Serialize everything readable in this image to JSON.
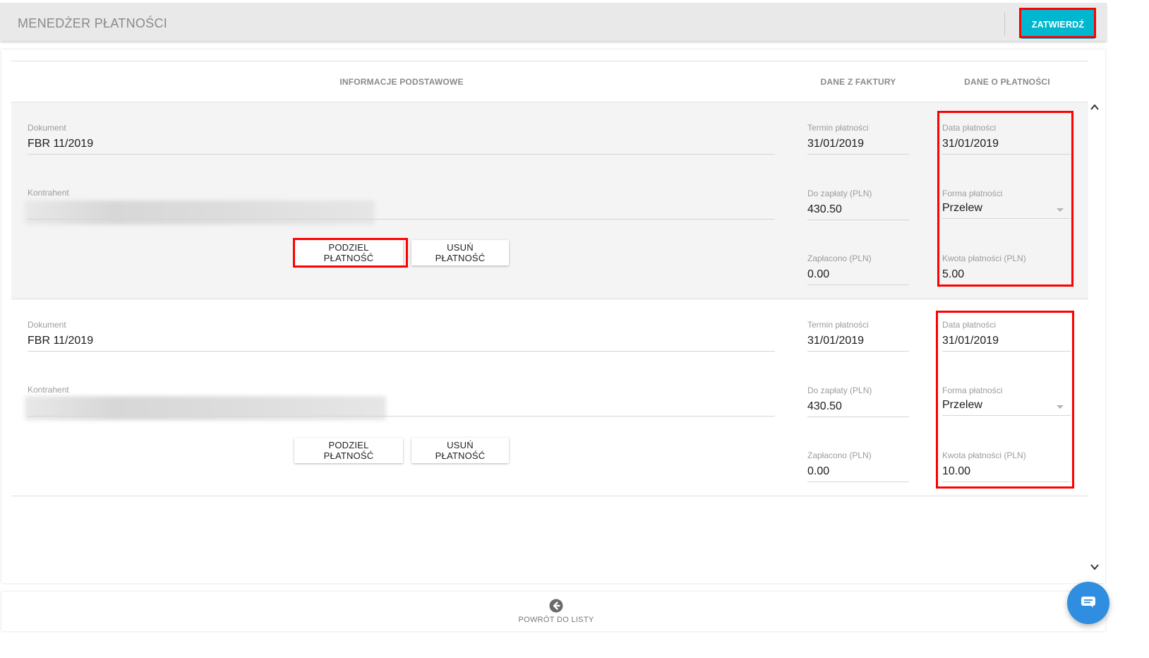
{
  "header": {
    "title": "MENEDŻER PŁATNOŚCI",
    "confirm_label": "ZATWIERDŹ"
  },
  "columns": {
    "basic_info": "INFORMACJE PODSTAWOWE",
    "invoice_data": "DANE Z FAKTURY",
    "payment_data": "DANE O PŁATNOŚCI"
  },
  "payments": [
    {
      "document_label": "Dokument",
      "document_value": "FBR 11/2019",
      "contractor_label": "Kontrahent",
      "due_date_label": "Termin płatności",
      "due_date_value": "31/01/2019",
      "to_pay_label": "Do zapłaty (PLN)",
      "to_pay_value": "430.50",
      "paid_label": "Zapłacono (PLN)",
      "paid_value": "0.00",
      "payment_date_label": "Data płatności",
      "payment_date_value": "31/01/2019",
      "payment_form_label": "Forma płatności",
      "payment_form_value": "Przelew",
      "payment_amount_label": "Kwota płatności (PLN)",
      "payment_amount_value": "5.00",
      "split_label": "PODZIEL PŁATNOŚĆ",
      "remove_label": "USUŃ PŁATNOŚĆ"
    },
    {
      "document_label": "Dokument",
      "document_value": "FBR 11/2019",
      "contractor_label": "Kontrahent",
      "due_date_label": "Termin płatności",
      "due_date_value": "31/01/2019",
      "to_pay_label": "Do zapłaty (PLN)",
      "to_pay_value": "430.50",
      "paid_label": "Zapłacono (PLN)",
      "paid_value": "0.00",
      "payment_date_label": "Data płatności",
      "payment_date_value": "31/01/2019",
      "payment_form_label": "Forma płatności",
      "payment_form_value": "Przelew",
      "payment_amount_label": "Kwota płatności (PLN)",
      "payment_amount_value": "10.00",
      "split_label": "PODZIEL PŁATNOŚĆ",
      "remove_label": "USUŃ PŁATNOŚĆ"
    }
  ],
  "footer": {
    "back_label": "POWRÓT DO LISTY",
    "back_icon": "arrow-left-circle-icon"
  },
  "colors": {
    "accent": "#00b7cf",
    "highlight": "#ff0000",
    "chat": "#2f8ee0"
  }
}
